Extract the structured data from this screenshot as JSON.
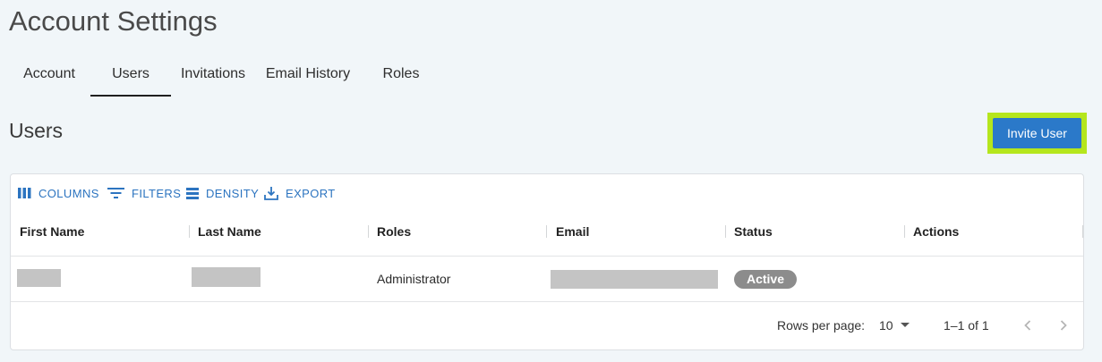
{
  "page": {
    "title": "Account Settings"
  },
  "tabs": [
    {
      "label": "Account",
      "active": false
    },
    {
      "label": "Users",
      "active": true
    },
    {
      "label": "Invitations",
      "active": false
    },
    {
      "label": "Email History",
      "active": false
    },
    {
      "label": "Roles",
      "active": false
    }
  ],
  "section": {
    "title": "Users",
    "invite_label": "Invite User"
  },
  "toolbar": {
    "columns": "COLUMNS",
    "filters": "FILTERS",
    "density": "DENSITY",
    "export": "EXPORT"
  },
  "table": {
    "headers": [
      "First Name",
      "Last Name",
      "Roles",
      "Email",
      "Status",
      "Actions"
    ],
    "rows": [
      {
        "role": "Administrator",
        "status": "Active"
      }
    ]
  },
  "pagination": {
    "rows_per_page_label": "Rows per page:",
    "rows_per_page_value": "10",
    "range": "1–1 of 1"
  },
  "colors": {
    "accent": "#2b79c9",
    "highlight": "#b5e61d",
    "status_chip": "#8c8c8c"
  }
}
